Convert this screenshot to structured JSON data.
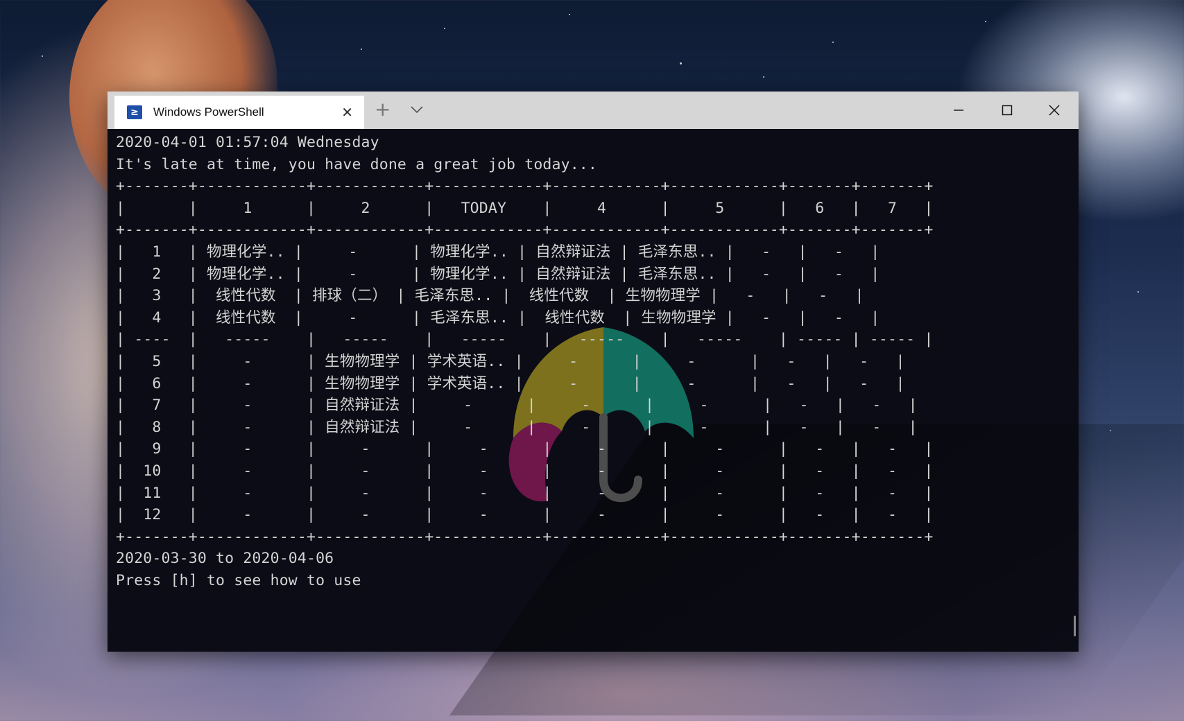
{
  "window": {
    "tab_title": "Windows PowerShell",
    "tab_close": "✕",
    "new_tab": "+",
    "tab_icon_glyph": "≥"
  },
  "terminal": {
    "header_line1": "2020-04-01 01:57:04 Wednesday",
    "header_line2": "It's late at time, you have done a great job today...",
    "table_columns": [
      "",
      "1",
      "2",
      "TODAY",
      "4",
      "5",
      "6",
      "7"
    ],
    "table_rows": [
      [
        "1",
        "物理化学..",
        "-",
        "物理化学..",
        "自然辩证法",
        "毛泽东思..",
        "-",
        "-"
      ],
      [
        "2",
        "物理化学..",
        "-",
        "物理化学..",
        "自然辩证法",
        "毛泽东思..",
        "-",
        "-"
      ],
      [
        "3",
        "线性代数",
        "排球（二）",
        "毛泽东思..",
        "线性代数",
        "生物物理学",
        "-",
        "-"
      ],
      [
        "4",
        "线性代数",
        "-",
        "毛泽东思..",
        "线性代数",
        "生物物理学",
        "-",
        "-"
      ],
      [
        "----",
        "-----",
        "-----",
        "-----",
        "-----",
        "-----",
        "-----",
        "-----"
      ],
      [
        "5",
        "-",
        "生物物理学",
        "学术英语..",
        "-",
        "-",
        "-",
        "-"
      ],
      [
        "6",
        "-",
        "生物物理学",
        "学术英语..",
        "-",
        "-",
        "-",
        "-"
      ],
      [
        "7",
        "-",
        "自然辩证法",
        "-",
        "-",
        "-",
        "-",
        "-"
      ],
      [
        "8",
        "-",
        "自然辩证法",
        "-",
        "-",
        "-",
        "-",
        "-"
      ],
      [
        "9",
        "-",
        "-",
        "-",
        "-",
        "-",
        "-",
        "-"
      ],
      [
        "10",
        "-",
        "-",
        "-",
        "-",
        "-",
        "-",
        "-"
      ],
      [
        "11",
        "-",
        "-",
        "-",
        "-",
        "-",
        "-",
        "-"
      ],
      [
        "12",
        "-",
        "-",
        "-",
        "-",
        "-",
        "-",
        "-"
      ]
    ],
    "footer_line1": "2020-03-30 to 2020-04-06",
    "footer_line2": "Press [h] to see how to use"
  },
  "icons": {
    "tab_icon": "powershell-icon",
    "dropdown": "chevron-down-icon",
    "minimize": "minimize-icon",
    "maximize": "maximize-icon",
    "close": "close-icon",
    "watermark": "umbrella-logo-icon"
  },
  "colors": {
    "terminal_bg": "#0c0c16",
    "terminal_fg": "#d4d4d4",
    "titlebar_bg": "#d6d6d6",
    "tab_bg": "#ffffff",
    "logo_yellow": "#8a7c1e",
    "logo_teal": "#137a68",
    "logo_magenta": "#7a1850"
  }
}
